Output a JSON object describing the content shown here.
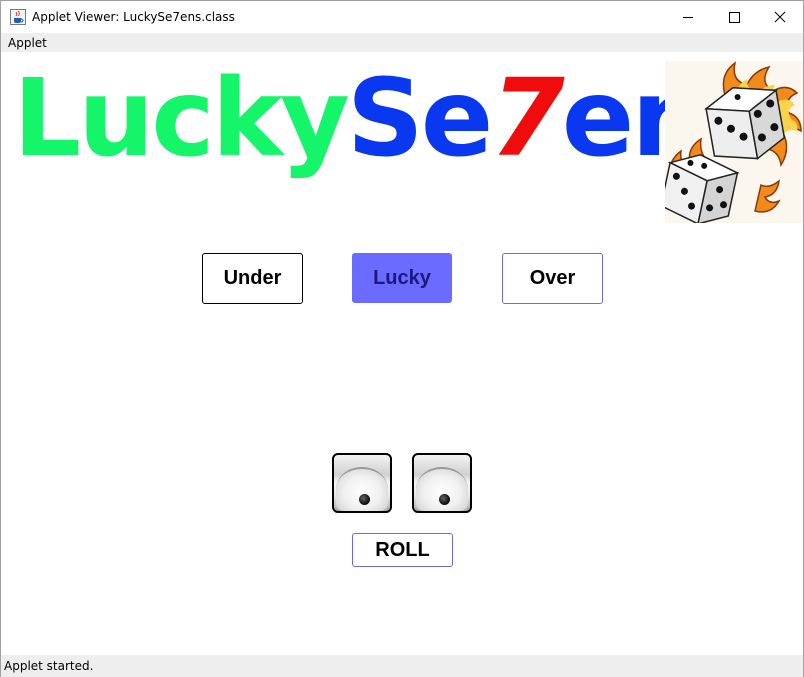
{
  "window": {
    "title": "Applet Viewer: LuckySe7ens.class",
    "icon": "java-cup-icon"
  },
  "menubar": {
    "items": [
      {
        "label": "Applet"
      }
    ]
  },
  "logo": {
    "part1": "Lucky",
    "part2": "Se",
    "part3": "7",
    "part4": "ens",
    "colors": {
      "lucky": "#15f56a",
      "se_ens": "#0a38f0",
      "seven": "#f00c0c"
    }
  },
  "bets": {
    "under": "Under",
    "lucky": "Lucky",
    "over": "Over",
    "selected": "Lucky",
    "selected_color": "#6b6bff"
  },
  "dice": [
    {
      "value": 1
    },
    {
      "value": 1
    }
  ],
  "roll": {
    "label": "ROLL"
  },
  "status": {
    "text": "Applet started."
  }
}
